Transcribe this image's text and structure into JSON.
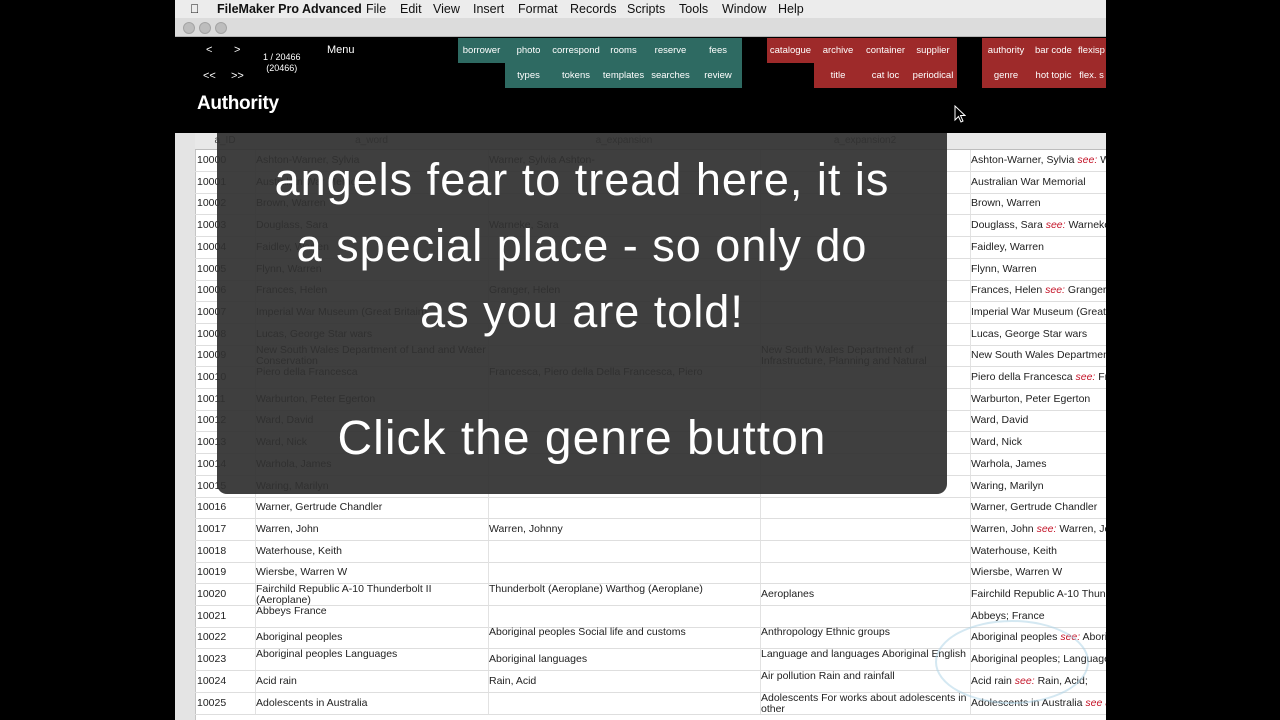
{
  "menubar": {
    "app_name": "FileMaker Pro Advanced",
    "items": [
      "File",
      "Edit",
      "View",
      "Insert",
      "Format",
      "Records",
      "Scripts",
      "Tools",
      "Window",
      "Help"
    ]
  },
  "header": {
    "nav": [
      "<",
      ">",
      "<<",
      ">>"
    ],
    "record_count": "1 / 20466",
    "found_count": "(20466)",
    "menu_label": "Menu",
    "layout_title": "Authority",
    "green_top": [
      "borrower",
      "photo",
      "correspond",
      "rooms",
      "reserve",
      "fees"
    ],
    "green_bottom": [
      "types",
      "tokens",
      "templates",
      "searches",
      "review"
    ],
    "red1_top": [
      "catalogue",
      "archive",
      "container",
      "supplier"
    ],
    "red1_bottom": [
      "title",
      "cat loc",
      "periodical"
    ],
    "red2_top": [
      "authority",
      "bar code",
      "flexisp"
    ],
    "red2_bottom": [
      "genre",
      "hot topic",
      "flex. s"
    ]
  },
  "columns": [
    "a_ID",
    "a_word",
    "a_expansion",
    "a_expansion2"
  ],
  "rows": [
    {
      "id": "10000",
      "w": "Ashton-Warner, Sylvia",
      "e": "Warner, Sylvia Ashton-",
      "e2": "",
      "d": "Ashton-Warner, Sylvia",
      "see": "see:",
      "d2": "Warner, Sylvia"
    },
    {
      "id": "10001",
      "w": "Australian War Memorial",
      "e": "",
      "e2": "",
      "d": "Australian War Memorial",
      "see": "",
      "d2": ""
    },
    {
      "id": "10002",
      "w": "Brown, Warren",
      "e": "",
      "e2": "",
      "d": "Brown, Warren",
      "see": "",
      "d2": ""
    },
    {
      "id": "10003",
      "w": "Douglass, Sara",
      "e": "Warneke, Sara",
      "e2": "",
      "d": "Douglass, Sara",
      "see": "see:",
      "d2": "Warneke"
    },
    {
      "id": "10004",
      "w": "Faidley, Warren",
      "e": "",
      "e2": "",
      "d": "Faidley, Warren",
      "see": "",
      "d2": ""
    },
    {
      "id": "10005",
      "w": "Flynn, Warren",
      "e": "",
      "e2": "",
      "d": "Flynn, Warren",
      "see": "",
      "d2": ""
    },
    {
      "id": "10006",
      "w": "Frances, Helen",
      "e": "Granger, Helen",
      "e2": "",
      "d": "Frances, Helen",
      "see": "see:",
      "d2": "Granger,"
    },
    {
      "id": "10007",
      "w": "Imperial War Museum (Great Britain)",
      "e": "",
      "e2": "",
      "d": "Imperial War Museum (Great",
      "see": "",
      "d2": ""
    },
    {
      "id": "10008",
      "w": "Lucas, George Star wars",
      "e": "",
      "e2": "",
      "d": "Lucas, George Star wars",
      "see": "",
      "d2": ""
    },
    {
      "id": "10009",
      "w": "New South Wales Department of Land and Water Conservation",
      "e": "",
      "e2": "New South Wales Department of Infrastructure, Planning and Natural",
      "d": "New South Wales Department",
      "see": "",
      "d2": ""
    },
    {
      "id": "10010",
      "w": "Piero della Francesca",
      "e": "Francesca, Piero della Della Francesca, Piero",
      "e2": "",
      "d": "Piero della Francesca",
      "see": "see:",
      "d2": "Fra"
    },
    {
      "id": "10011",
      "w": "Warburton, Peter Egerton",
      "e": "",
      "e2": "",
      "d": "Warburton, Peter Egerton",
      "see": "",
      "d2": ""
    },
    {
      "id": "10012",
      "w": "Ward, David",
      "e": "",
      "e2": "",
      "d": "Ward, David",
      "see": "",
      "d2": ""
    },
    {
      "id": "10013",
      "w": "Ward, Nick",
      "e": "",
      "e2": "",
      "d": "Ward, Nick",
      "see": "",
      "d2": ""
    },
    {
      "id": "10014",
      "w": "Warhola, James",
      "e": "",
      "e2": "",
      "d": "Warhola, James",
      "see": "",
      "d2": ""
    },
    {
      "id": "10015",
      "w": "Waring, Marilyn",
      "e": "",
      "e2": "",
      "d": "Waring, Marilyn",
      "see": "",
      "d2": ""
    },
    {
      "id": "10016",
      "w": "Warner, Gertrude Chandler",
      "e": "",
      "e2": "",
      "d": "Warner, Gertrude Chandler",
      "see": "",
      "d2": ""
    },
    {
      "id": "10017",
      "w": "Warren, John",
      "e": "Warren, Johnny",
      "e2": "",
      "d": "Warren, John",
      "see": "see:",
      "d2": "Warren, Jo"
    },
    {
      "id": "10018",
      "w": "Waterhouse, Keith",
      "e": "",
      "e2": "",
      "d": "Waterhouse, Keith",
      "see": "",
      "d2": ""
    },
    {
      "id": "10019",
      "w": "Wiersbe, Warren W",
      "e": "",
      "e2": "",
      "d": "Wiersbe, Warren W",
      "see": "",
      "d2": ""
    },
    {
      "id": "10020",
      "w": "Fairchild Republic A-10 Thunderbolt II (Aeroplane)",
      "e": "Thunderbolt (Aeroplane) Warthog (Aeroplane)",
      "e2": "Aeroplanes",
      "d": "Fairchild Republic A-10 Thund",
      "see": "",
      "d2": ""
    },
    {
      "id": "10021",
      "w": "Abbeys France",
      "e": "",
      "e2": "",
      "d": "Abbeys; France",
      "see": "",
      "d2": ""
    },
    {
      "id": "10022",
      "w": "Aboriginal peoples",
      "e": "Aboriginal peoples Social life and customs",
      "e2": "Anthropology Ethnic groups",
      "d": "Aboriginal peoples",
      "see": "see:",
      "d2": "Aborigi"
    },
    {
      "id": "10023",
      "w": "Aboriginal peoples Languages",
      "e": "Aboriginal languages",
      "e2": "Language and languages Aboriginal English",
      "d": "Aboriginal peoples; Language",
      "see": "",
      "d2": ""
    },
    {
      "id": "10024",
      "w": "Acid rain",
      "e": "Rain, Acid",
      "e2": "Air pollution Rain and rainfall",
      "d": "Acid rain",
      "see": "see:",
      "d2": "Rain, Acid;"
    },
    {
      "id": "10025",
      "w": "Adolescents in Australia",
      "e": "",
      "e2": "Adolescents For works about adolescents in other",
      "d": "Adolescents in Australia",
      "see": "see als",
      "d2": ""
    }
  ],
  "overlay": {
    "line1": "angels fear to tread here, it is",
    "line2": "a special place - so only do",
    "line3": "as you are told!",
    "instruction": "Click the genre button"
  }
}
